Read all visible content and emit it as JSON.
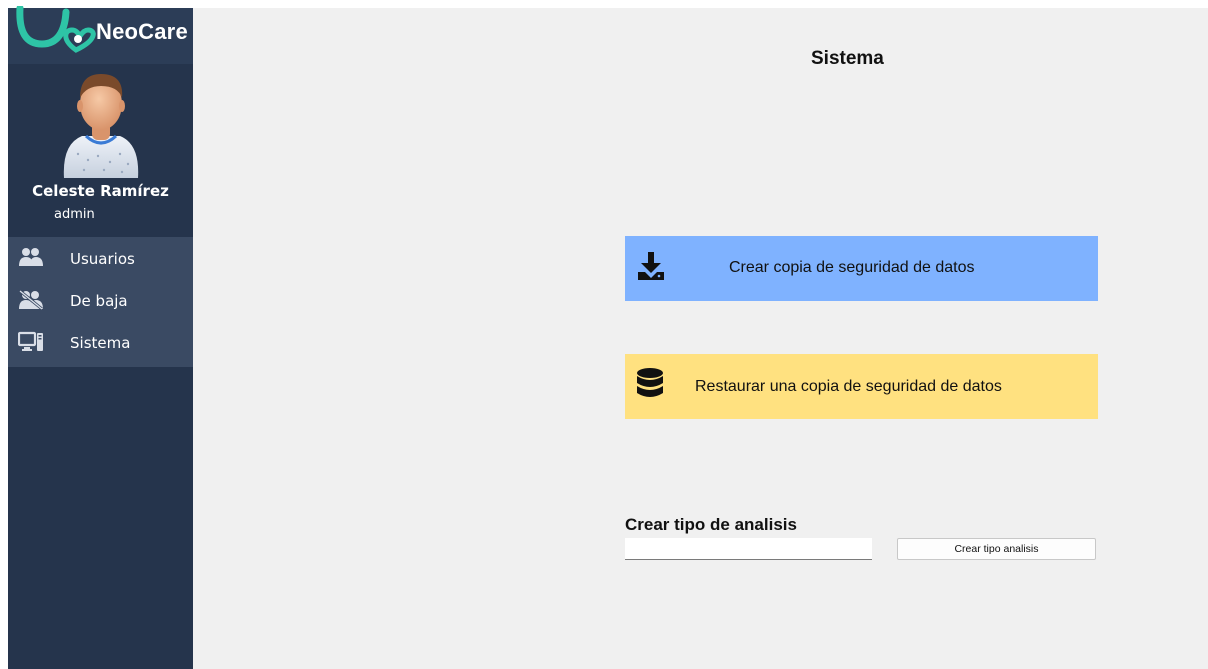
{
  "app": {
    "logo_text": "NeoCare",
    "logo_color": "#2ec4a6"
  },
  "user": {
    "name": "Celeste Ramírez",
    "role": "admin"
  },
  "sidebar": {
    "items": [
      {
        "label": "Usuarios",
        "icon": "users-icon"
      },
      {
        "label": "De baja",
        "icon": "users-removed-icon"
      },
      {
        "label": "Sistema",
        "icon": "computer-icon"
      }
    ]
  },
  "main": {
    "title": "Sistema",
    "backup": {
      "label": "Crear copia de seguridad de datos",
      "icon": "download-icon",
      "color": "#7fb2ff"
    },
    "restore": {
      "label": "Restaurar una copia de seguridad de datos",
      "icon": "database-icon",
      "color": "#ffe180"
    },
    "analysis": {
      "title": "Crear tipo de analisis",
      "input_value": "",
      "button_label": "Crear tipo analisis"
    }
  }
}
